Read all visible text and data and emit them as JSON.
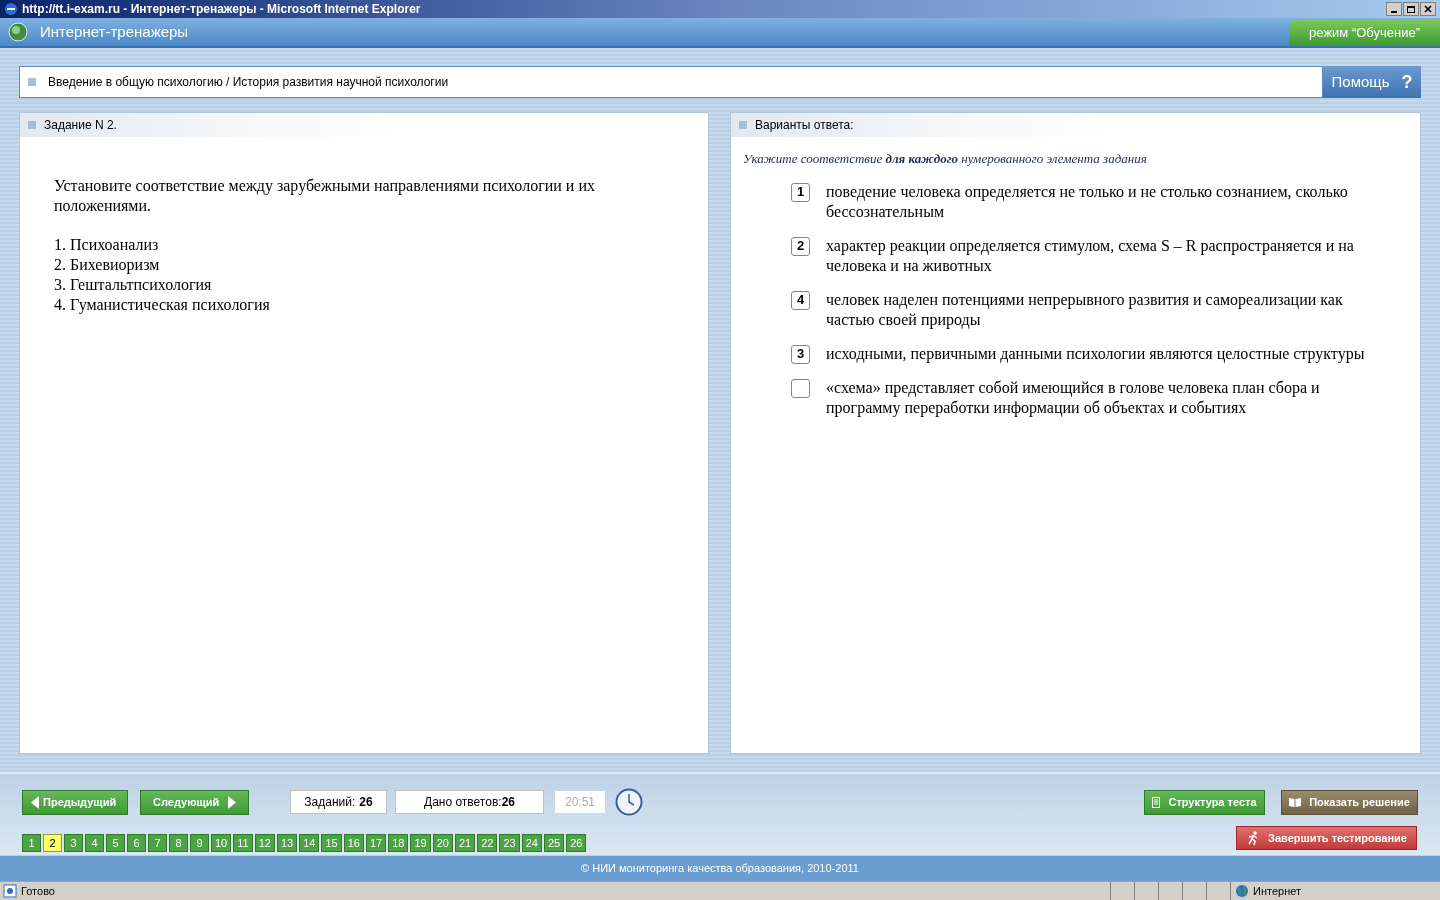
{
  "window": {
    "title": "http://tt.i-exam.ru - Интернет-тренажеры - Microsoft Internet Explorer"
  },
  "header": {
    "title": "Интернет-тренажеры",
    "mode": "режим “Обучение”"
  },
  "breadcrumb": {
    "text": "Введение в общую психологию / История развития научной психологии",
    "help": "Помощь",
    "help_icon": "?"
  },
  "task": {
    "heading": "Задание N 2.",
    "question": "Установите соответствие между зарубежными направлениями психологии и их положениями.",
    "items": [
      "1. Психоанализ",
      "2. Бихевиоризм",
      "3. Гештальтпсихология",
      "4. Гуманистическая психология"
    ]
  },
  "answers": {
    "heading": "Варианты ответа:",
    "instruction": "Укажите соответствие **для каждого** нумерованного элемента задания",
    "options": [
      {
        "value": "1",
        "text": "поведение человека определяется не только и не столько сознанием, сколько бессознательным"
      },
      {
        "value": "2",
        "text": "характер реакции определяется стимулом, схема S – R распространяется и на человека и на животных"
      },
      {
        "value": "4",
        "text": "человек наделен потенциями непрерывного развития и самореализации как частью своей природы"
      },
      {
        "value": "3",
        "text": "исходными, первичными данными психологии являются целостные структуры"
      },
      {
        "text": "«схема» представляет собой имеющийся в голове человека план сбора и программу переработки информации об объектах и событиях"
      }
    ]
  },
  "footer": {
    "prev": "Предыдущий",
    "next": "Следующий",
    "tasks_label": "Заданий:",
    "tasks_count": "26",
    "answered_label": "Дано ответов:",
    "answered_count": "26",
    "timer": "20:51",
    "structure": "Структура теста",
    "show_solution": "Показать решение",
    "finish": "Завершить тестирование",
    "pages": [
      {
        "label": "1",
        "selected": false
      },
      {
        "label": "2",
        "selected": true
      },
      {
        "label": "3",
        "selected": false
      },
      {
        "label": "4",
        "selected": false
      },
      {
        "label": "5",
        "selected": false
      },
      {
        "label": "6",
        "selected": false
      },
      {
        "label": "7",
        "selected": false
      },
      {
        "label": "8",
        "selected": false
      },
      {
        "label": "9",
        "selected": false
      },
      {
        "label": "10",
        "selected": false
      },
      {
        "label": "11",
        "selected": false
      },
      {
        "label": "12",
        "selected": false
      },
      {
        "label": "13",
        "selected": false
      },
      {
        "label": "14",
        "selected": false
      },
      {
        "label": "15",
        "selected": false
      },
      {
        "label": "16",
        "selected": false
      },
      {
        "label": "17",
        "selected": false
      },
      {
        "label": "18",
        "selected": false
      },
      {
        "label": "19",
        "selected": false
      },
      {
        "label": "20",
        "selected": false
      },
      {
        "label": "21",
        "selected": false
      },
      {
        "label": "22",
        "selected": false
      },
      {
        "label": "23",
        "selected": false
      },
      {
        "label": "24",
        "selected": false
      },
      {
        "label": "25",
        "selected": false
      },
      {
        "label": "26",
        "selected": false
      }
    ],
    "copyright": "© НИИ мониторинга качества образования, 2010-2011"
  },
  "status_bar": {
    "text": "Готово",
    "zone": "Интернет"
  }
}
